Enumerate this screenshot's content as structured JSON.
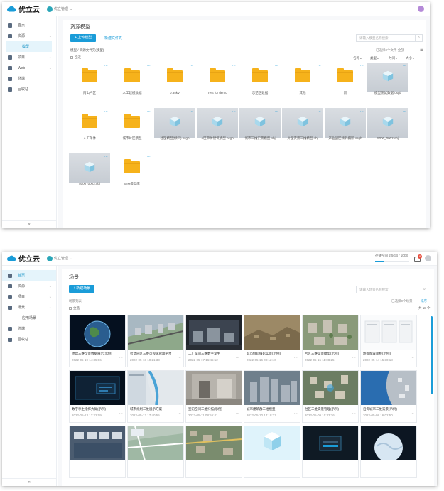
{
  "brand": {
    "name": "优立云",
    "workspace": "优立管理",
    "workspace2": "优立管理"
  },
  "w1": {
    "sidebar": [
      {
        "label": "首页",
        "icon": "home-icon",
        "chev": ""
      },
      {
        "label": "资源",
        "icon": "resource-icon",
        "chev": "⌄"
      },
      {
        "label": "项目",
        "icon": "project-icon",
        "chev": "⌄"
      },
      {
        "label": "Web",
        "icon": "web-icon",
        "chev": "⌄"
      },
      {
        "label": "终端",
        "icon": "terminal-icon",
        "chev": ""
      },
      {
        "label": "回收站",
        "icon": "trash-icon",
        "chev": ""
      }
    ],
    "sub_active": "模型",
    "collapse": "«",
    "title": "资源模型",
    "upload": "+ 上传模型",
    "new_folder": "新建文件夹",
    "search_placeholder": "请输入模型名称搜索",
    "breadcrumb": "模型 / 资源文件夹(模型)",
    "select_all": "全选",
    "meta_right": "已选择0个文件  全部",
    "sort": [
      "名称⌄",
      "类型⌄",
      "时间⌄",
      "大小⌄"
    ],
    "items": [
      {
        "type": "folder",
        "label": "南山片区"
      },
      {
        "type": "folder",
        "label": "人工建模数据"
      },
      {
        "type": "folder",
        "label": "0.35kV"
      },
      {
        "type": "folder",
        "label": "Test for demo"
      },
      {
        "type": "folder",
        "label": "示范区数据"
      },
      {
        "type": "folder",
        "label": "其他"
      },
      {
        "type": "folder",
        "label": "新"
      },
      {
        "type": "model",
        "label": "模型测试数据.osgb"
      },
      {
        "type": "folder",
        "label": "人工单体"
      },
      {
        "type": "folder",
        "label": "城市片区模型"
      },
      {
        "type": "model",
        "label": "社区模型(倾斜).osgb"
      },
      {
        "type": "model",
        "label": "A区单体建筑模型.osgb"
      },
      {
        "type": "model",
        "label": "城市三维实景模型.obj"
      },
      {
        "type": "model",
        "label": "片区实景三维模型.obj"
      },
      {
        "type": "model",
        "label": "产业园区倾斜摄影.osgb"
      },
      {
        "type": "model",
        "label": "5000_0002.obj"
      },
      {
        "type": "model",
        "label": "5000_0003.obj"
      },
      {
        "type": "folder",
        "label": "BIM模型库"
      }
    ]
  },
  "w2": {
    "sidebar": [
      {
        "label": "首页",
        "icon": "home-icon",
        "chev": ""
      },
      {
        "label": "资源",
        "icon": "resource-icon",
        "chev": "⌄"
      },
      {
        "label": "项目",
        "icon": "project-icon",
        "chev": "⌄"
      },
      {
        "label": "场景",
        "icon": "scene-icon",
        "chev": "⌄"
      },
      {
        "label": "终端",
        "icon": "terminal-icon",
        "chev": ""
      },
      {
        "label": "回收站",
        "icon": "trash-icon",
        "chev": ""
      }
    ],
    "sub_active": "应用场景",
    "collapse": "«",
    "storage": "存储空间 2.5GB / 10GB",
    "storage_frac": 0.25,
    "notif_count": "8",
    "title": "场景",
    "new_scene": "+ 新建场景",
    "search_placeholder": "请输入场景名称搜索",
    "crumb": "场景列表",
    "select_all": "全选",
    "right_meta": "已选择0个场景",
    "right_meta2": "排序",
    "count": "共 18 个",
    "cards": [
      {
        "title": "地球三维全景数据展示(示例)",
        "date": "2022-05-19 14:35:06",
        "img": "earth"
      },
      {
        "title": "智慧园区三维可视化管理平台",
        "date": "2022-05-18 10:21:33",
        "img": "city"
      },
      {
        "title": "工厂车间三维数字孪生",
        "date": "2022-05-17 16:45:12",
        "img": "factory"
      },
      {
        "title": "城市倾斜摄影实景(示例)",
        "date": "2022-05-16 09:12:40",
        "img": "terrain"
      },
      {
        "title": "片区三维实景模型(示例)",
        "date": "2022-05-15 11:08:25",
        "img": "aerial"
      },
      {
        "title": "场景配置面板(示例)",
        "date": "2022-05-14 15:30:18",
        "img": "ui"
      },
      {
        "title": "数字孪生指挥大屏(示例)",
        "date": "2022-05-13 13:22:09",
        "img": "dark"
      },
      {
        "title": "城市规划三维展示方案",
        "date": "2022-05-12 17:40:55",
        "img": "map"
      },
      {
        "title": "室内空间三维扫描(示例)",
        "date": "2022-05-11 08:55:41",
        "img": "indoor"
      },
      {
        "title": "城市建筑群三维模型",
        "date": "2022-05-10 14:18:27",
        "img": "buildings"
      },
      {
        "title": "社区三维实景管理(示例)",
        "date": "2022-05-09 10:33:16",
        "img": "aerial2"
      },
      {
        "title": "沿海城市三维实景(示例)",
        "date": "2022-05-08 16:02:50",
        "img": "coast"
      },
      {
        "title": "",
        "date": "",
        "img": "control"
      },
      {
        "title": "",
        "date": "",
        "img": "map2"
      },
      {
        "title": "",
        "date": "",
        "img": "aerial3"
      },
      {
        "title": "",
        "date": "",
        "img": "cube"
      },
      {
        "title": "",
        "date": "",
        "img": "login"
      },
      {
        "title": "",
        "date": "",
        "img": "globe"
      }
    ]
  },
  "colors": {
    "accent": "#1a9cd8",
    "folder": "#f6b21b",
    "active_bg": "#e5f4fb"
  }
}
